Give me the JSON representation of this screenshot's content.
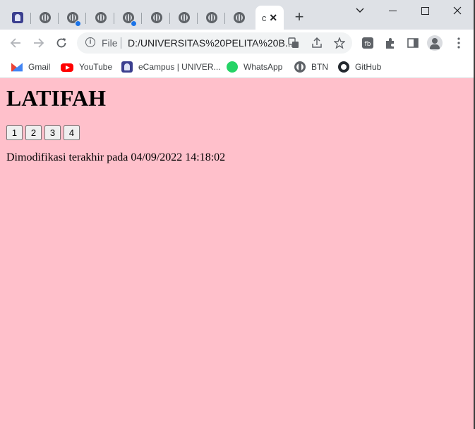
{
  "browser": {
    "tabs": [
      {
        "favicon": "campus-icon",
        "active": false,
        "loading_dot": false
      },
      {
        "favicon": "globe-icon",
        "active": false,
        "loading_dot": false
      },
      {
        "favicon": "globe-icon",
        "active": false,
        "loading_dot": true
      },
      {
        "favicon": "globe-icon",
        "active": false,
        "loading_dot": false
      },
      {
        "favicon": "globe-icon",
        "active": false,
        "loading_dot": true
      },
      {
        "favicon": "globe-icon",
        "active": false,
        "loading_dot": false
      },
      {
        "favicon": "globe-icon",
        "active": false,
        "loading_dot": false
      },
      {
        "favicon": "globe-icon",
        "active": false,
        "loading_dot": false
      },
      {
        "favicon": "globe-icon",
        "active": false,
        "loading_dot": false
      }
    ],
    "active_tab": {
      "title": "c",
      "close": "✕"
    },
    "new_tab": "+",
    "window_controls": {
      "dropdown": "⌄",
      "minimize": "—",
      "maximize": "☐",
      "close": "✕"
    },
    "nav": {
      "back": "←",
      "forward": "→",
      "reload": "↻"
    },
    "omnibox": {
      "scheme": "File",
      "url": "D:/UNIVERSITAS%20PELITA%20B..."
    },
    "bookmarks": [
      {
        "label": "Gmail",
        "icon": "gmail-icon"
      },
      {
        "label": "YouTube",
        "icon": "youtube-icon"
      },
      {
        "label": "eCampus | UNIVER...",
        "icon": "campus-icon"
      },
      {
        "label": "WhatsApp",
        "icon": "whatsapp-icon"
      },
      {
        "label": "BTN",
        "icon": "globe-icon"
      },
      {
        "label": "GitHub",
        "icon": "github-icon"
      }
    ]
  },
  "page": {
    "heading": "LATIFAH",
    "buttons": [
      "1",
      "2",
      "3",
      "4"
    ],
    "modified_text": "Dimodifikasi terakhir pada 04/09/2022 14:18:02",
    "background": "#ffc0cb"
  }
}
